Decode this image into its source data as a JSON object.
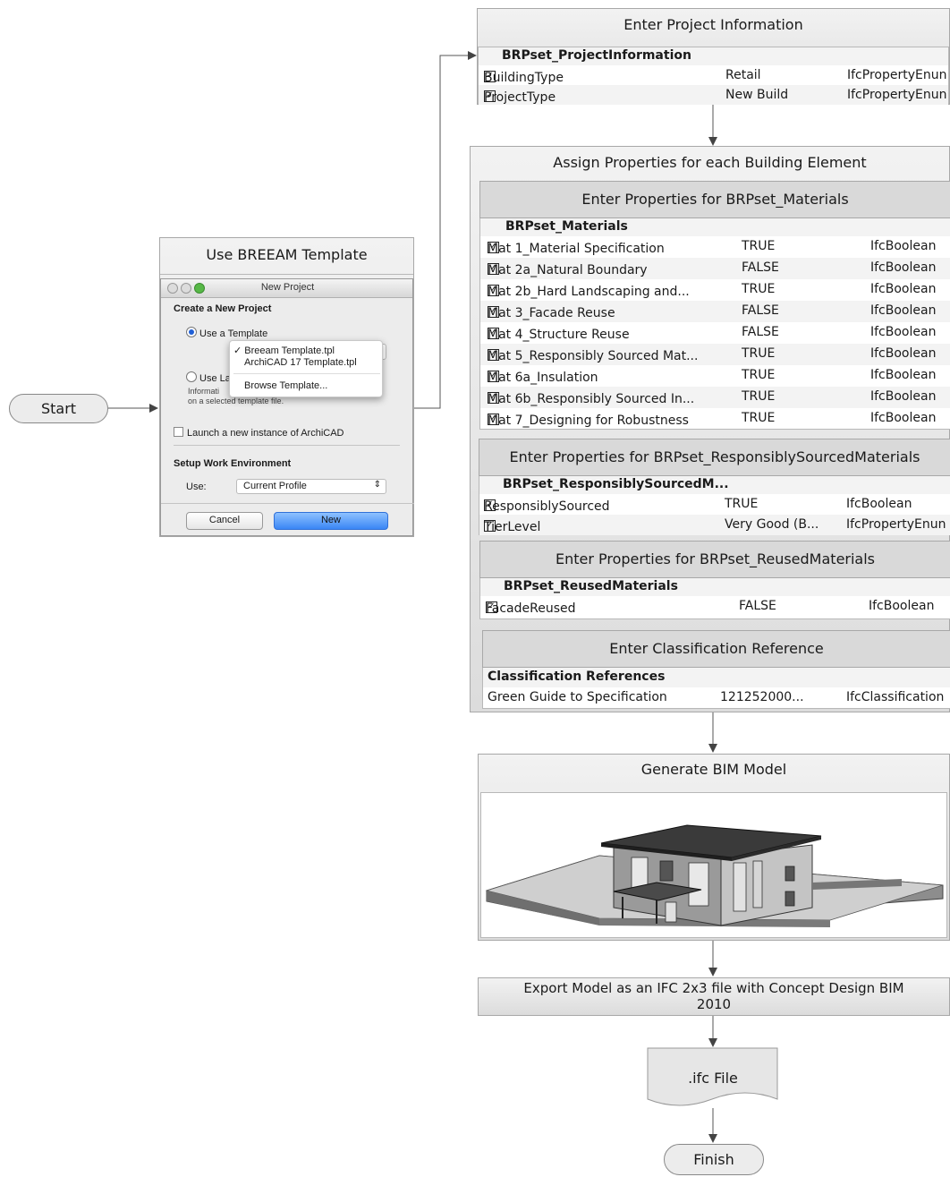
{
  "start": "Start",
  "finish": "Finish",
  "template_step": {
    "title": "Use BREEAM Template",
    "dialog": {
      "window_title": "New Project",
      "create_heading": "Create a New Project",
      "use_template": "Use a Template",
      "popup_items": [
        "Breeam Template.tpl",
        "ArchiCAD 17 Template.tpl"
      ],
      "popup_browse": "Browse Template...",
      "use_latest_partial": "Use La",
      "info_partial": "Informati",
      "info_line2": "on a selected template file.",
      "launch_new": "Launch a new instance of ArchiCAD",
      "setup_heading": "Setup Work Environment",
      "use_label": "Use:",
      "profile": "Current Profile",
      "cancel": "Cancel",
      "new": "New"
    }
  },
  "project_info": {
    "title": "Enter Project Information",
    "set_name": "BRPset_ProjectInformation",
    "rows": [
      {
        "name": "BuildingType",
        "value": "Retail",
        "type": "IfcPropertyEnun"
      },
      {
        "name": "ProjectType",
        "value": "New Build",
        "type": "IfcPropertyEnun"
      }
    ]
  },
  "assign": {
    "title": "Assign Properties for each Building Element",
    "materials": {
      "title": "Enter Properties for BRPset_Materials",
      "set_name": "BRPset_Materials",
      "rows": [
        {
          "name": "Mat 1_Material Specification",
          "value": "TRUE",
          "type": "IfcBoolean"
        },
        {
          "name": "Mat 2a_Natural Boundary",
          "value": "FALSE",
          "type": "IfcBoolean"
        },
        {
          "name": "Mat 2b_Hard Landscaping and...",
          "value": "TRUE",
          "type": "IfcBoolean"
        },
        {
          "name": "Mat 3_Facade Reuse",
          "value": "FALSE",
          "type": "IfcBoolean"
        },
        {
          "name": "Mat 4_Structure Reuse",
          "value": "FALSE",
          "type": "IfcBoolean"
        },
        {
          "name": "Mat 5_Responsibly Sourced Mat...",
          "value": "TRUE",
          "type": "IfcBoolean"
        },
        {
          "name": "Mat 6a_Insulation",
          "value": "TRUE",
          "type": "IfcBoolean"
        },
        {
          "name": "Mat 6b_Responsibly Sourced In...",
          "value": "TRUE",
          "type": "IfcBoolean"
        },
        {
          "name": "Mat 7_Designing for Robustness",
          "value": "TRUE",
          "type": "IfcBoolean"
        }
      ]
    },
    "responsible": {
      "title": "Enter Properties for BRPset_ResponsiblySourcedMaterials",
      "set_name": "BRPset_ResponsiblySourcedM...",
      "rows": [
        {
          "name": "ResponsiblySourced",
          "value": "TRUE",
          "type": "IfcBoolean"
        },
        {
          "name": "TierLevel",
          "value": "Very Good (B...",
          "type": "IfcPropertyEnun"
        }
      ]
    },
    "reused": {
      "title": "Enter Properties for BRPset_ReusedMaterials",
      "set_name": "BRPset_ReusedMaterials",
      "rows": [
        {
          "name": "FacadeReused",
          "value": "FALSE",
          "type": "IfcBoolean"
        }
      ]
    },
    "classification": {
      "title": "Enter Classification Reference",
      "set_name": "Classification References",
      "rows": [
        {
          "name": "Green Guide to Specification",
          "value": "121252000...",
          "type": "IfcClassification"
        }
      ]
    }
  },
  "bim": {
    "title": "Generate BIM Model"
  },
  "export": {
    "line1": "Export Model as an IFC 2x3 file with Concept Design BIM",
    "line2": "2010"
  },
  "file": ".ifc File"
}
